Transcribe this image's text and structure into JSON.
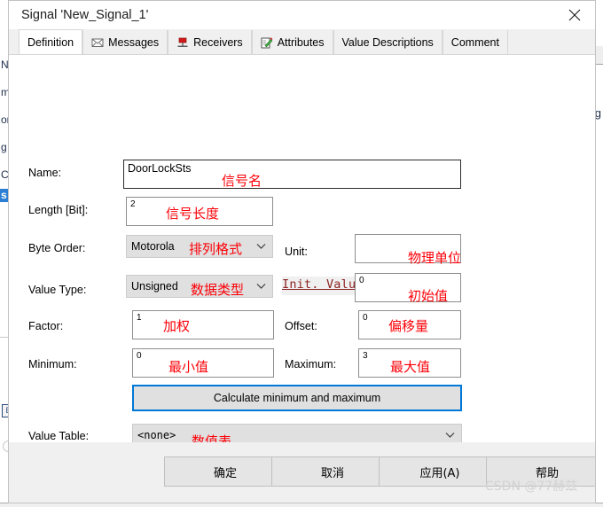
{
  "window": {
    "title": "Signal 'New_Signal_1'",
    "close_icon": "close-icon"
  },
  "tabs": [
    {
      "label": "Definition",
      "icon": "",
      "selected": true
    },
    {
      "label": "Messages",
      "icon": "envelope-icon",
      "selected": false
    },
    {
      "label": "Receivers",
      "icon": "pin-icon",
      "selected": false
    },
    {
      "label": "Attributes",
      "icon": "note-pencil-icon",
      "selected": false
    },
    {
      "label": "Value Descriptions",
      "icon": "",
      "selected": false
    },
    {
      "label": "Comment",
      "icon": "",
      "selected": false
    }
  ],
  "form": {
    "name": {
      "label": "Name:",
      "value": "DoorLockSts",
      "annotation": "信号名"
    },
    "length": {
      "label": "Length [Bit]:",
      "value": "2",
      "annotation": "信号长度"
    },
    "byte_order": {
      "label": "Byte Order:",
      "value": "Motorola",
      "annotation": "排列格式",
      "arrow": "chevron-down-icon"
    },
    "unit": {
      "label": "Unit:",
      "value": "",
      "annotation": "物理单位"
    },
    "value_type": {
      "label": "Value Type:",
      "value": "Unsigned",
      "annotation": "数据类型",
      "arrow": "chevron-down-icon"
    },
    "init_value": {
      "label": "Init. Value",
      "value": "0",
      "annotation": "初始值"
    },
    "factor": {
      "label": "Factor:",
      "value": "1",
      "annotation": "加权"
    },
    "offset": {
      "label": "Offset:",
      "value": "0",
      "annotation": "偏移量"
    },
    "minimum": {
      "label": "Minimum:",
      "value": "0",
      "annotation": "最小值"
    },
    "maximum": {
      "label": "Maximum:",
      "value": "3",
      "annotation": "最大值"
    },
    "calculate_button": {
      "label": "Calculate minimum and maximum"
    },
    "value_table": {
      "label": "Value Table:",
      "value": "<none>",
      "annotation": "数值表",
      "arrow": "chevron-down-icon"
    }
  },
  "buttons": {
    "ok": "确定",
    "cancel": "取消",
    "apply": "应用(A)",
    "help": "帮助"
  },
  "watermark": "CSDN @77赫兹",
  "background": {
    "left_tree": [
      "N",
      "m",
      "or",
      "g",
      "C",
      "s"
    ],
    "left_icon_glyph": "E",
    "right_text": "ig"
  },
  "colors": {
    "accent": "#0078d7",
    "annotation": "#fb0007",
    "link": "#8d2323",
    "dialog_bg": "#ffffff",
    "panel_bg": "#f0f0f0"
  }
}
